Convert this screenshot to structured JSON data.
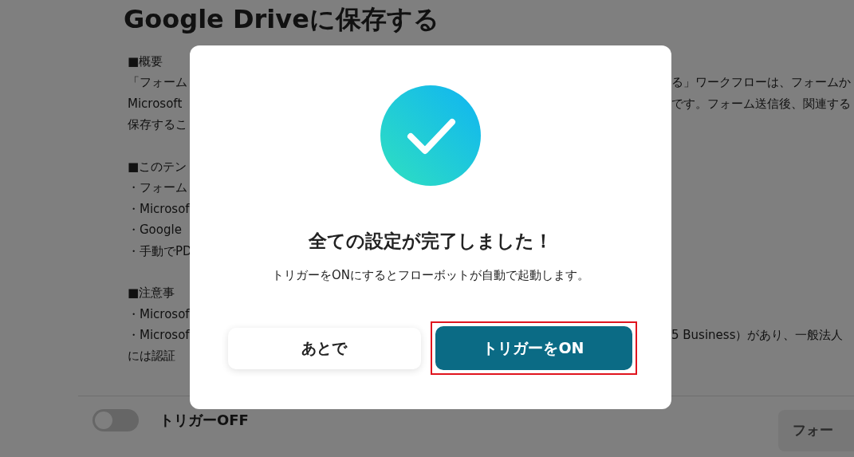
{
  "page": {
    "title": "Google Driveに保存する",
    "sections": [
      {
        "lines": [
          {
            "left": "■概要"
          },
          {
            "left": "「フォーム",
            "right": "る」ワークフローは、フォームか"
          },
          {
            "left": "Microsoft",
            "right": "です。フォーム送信後、関連する"
          },
          {
            "left": "保存するこ"
          }
        ]
      },
      {
        "lines": [
          {
            "left": "■このテン"
          },
          {
            "left": "・フォーム"
          },
          {
            "left": "・Microsof"
          },
          {
            "left": "・Google"
          },
          {
            "left": "・手動でPD"
          }
        ]
      },
      {
        "lines": [
          {
            "left": "■注意事"
          },
          {
            "left": "・Microsof"
          },
          {
            "left": "・Microsof",
            "right": "5 Business）があり、一般法人"
          },
          {
            "left": "には認証"
          }
        ]
      }
    ],
    "trigger": {
      "on": false,
      "label": "トリガーOFF"
    },
    "action_button": "フォー"
  },
  "dialog": {
    "title": "全ての設定が完了しました！",
    "message": "トリガーをONにするとフローボットが自動で起動します。",
    "buttons": [
      {
        "label": "あとで",
        "kind": "secondary",
        "highlighted": false
      },
      {
        "label": "トリガーをON",
        "kind": "primary",
        "highlighted": true
      }
    ]
  }
}
